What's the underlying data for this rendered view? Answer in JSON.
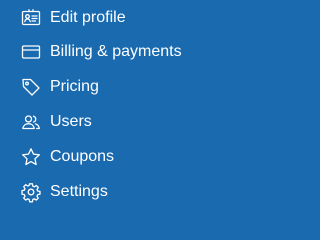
{
  "theme": {
    "background": "#1a6ab0",
    "foreground": "#ffffff"
  },
  "menu": {
    "items": [
      {
        "label": "Edit profile",
        "icon": "id-card-icon"
      },
      {
        "label": "Billing & payments",
        "icon": "credit-card-icon"
      },
      {
        "label": "Pricing",
        "icon": "price-tag-icon"
      },
      {
        "label": "Users",
        "icon": "users-icon"
      },
      {
        "label": "Coupons",
        "icon": "star-icon"
      },
      {
        "label": "Settings",
        "icon": "gear-icon"
      }
    ]
  }
}
